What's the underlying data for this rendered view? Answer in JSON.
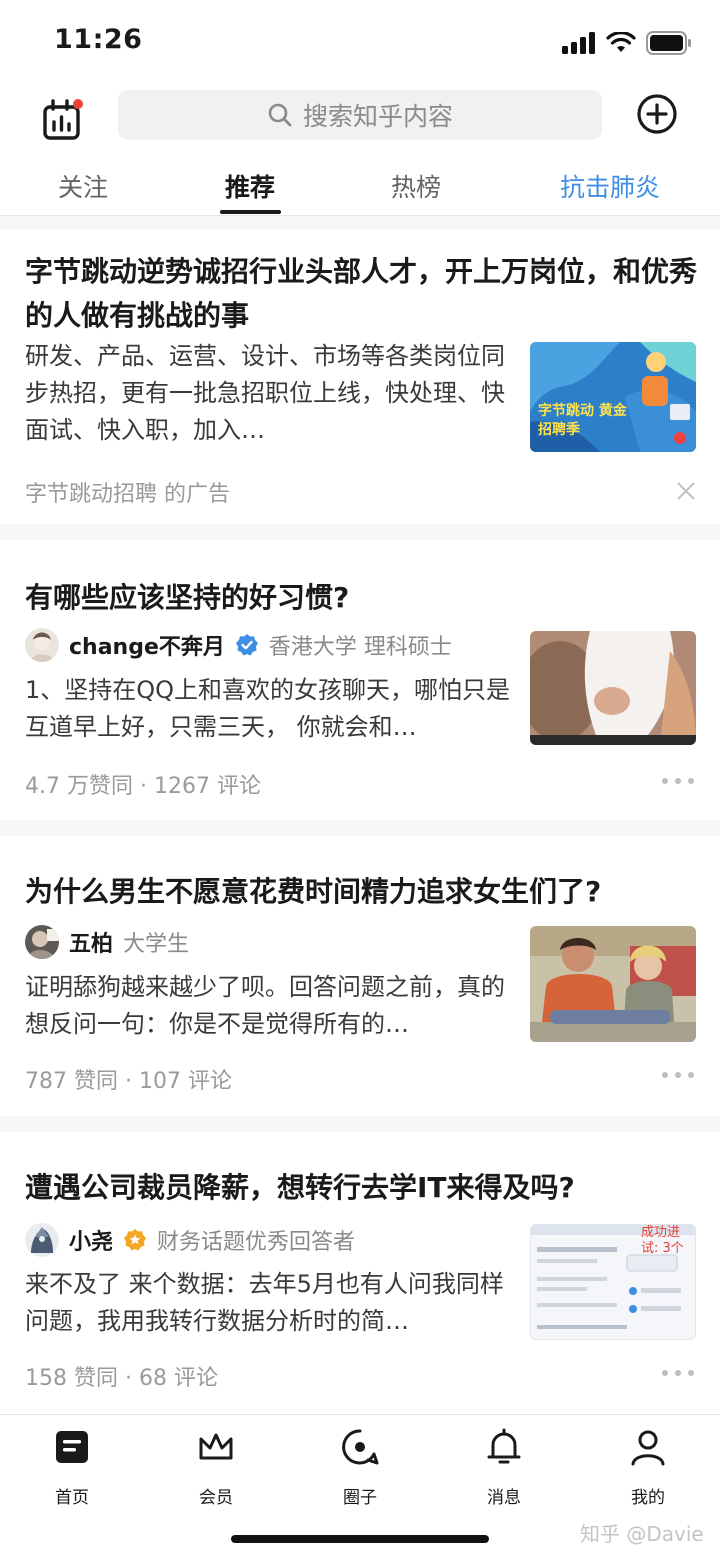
{
  "status_bar": {
    "time": "11:26"
  },
  "header": {
    "search_placeholder": "搜索知乎内容",
    "tabs": [
      {
        "label": "关注"
      },
      {
        "label": "推荐"
      },
      {
        "label": "热榜"
      },
      {
        "label": "抗击肺炎"
      }
    ],
    "active_tab": "推荐"
  },
  "feed": {
    "ad": {
      "title": "字节跳动逆势诚招行业头部人才，开上万岗位，和优秀的人做有挑战的事",
      "excerpt": "研发、产品、运营、设计、市场等各类岗位同步热招，更有一批急招职位上线，快处理、快面试、快入职，加入…",
      "thumb_text": "字节跳动 黄金招聘季",
      "sponsor": "字节跳动招聘 的广告"
    },
    "items": [
      {
        "title": "有哪些应该坚持的好习惯?",
        "author": "change不奔月",
        "verified": true,
        "bio": "香港大学 理科硕士",
        "excerpt": "1、坚持在QQ上和喜欢的女孩聊天，哪怕只是互道早上好，只需三天， 你就会和…",
        "stats": "4.7 万赞同 · 1267 评论"
      },
      {
        "title": "为什么男生不愿意花费时间精力追求女生们了?",
        "author": "五柏",
        "verified": false,
        "bio": "大学生",
        "excerpt": "证明舔狗越来越少了呗。回答问题之前，真的想反问一句：你是不是觉得所有的…",
        "stats": "787 赞同 · 107 评论"
      },
      {
        "title": "遭遇公司裁员降薪，想转行去学IT来得及吗?",
        "author": "小尧",
        "verified": true,
        "bio": "财务话题优秀回答者",
        "excerpt": "来不及了 来个数据：去年5月也有人问我同样问题，我用我转行数据分析时的简…",
        "stats": "158 赞同 · 68 评论",
        "thumb_text": "成功进 试: 3个"
      }
    ]
  },
  "bottom_nav": [
    {
      "label": "首页",
      "icon": "home-icon"
    },
    {
      "label": "会员",
      "icon": "crown-icon"
    },
    {
      "label": "圈子",
      "icon": "circle-chat-icon"
    },
    {
      "label": "消息",
      "icon": "bell-icon"
    },
    {
      "label": "我的",
      "icon": "person-icon"
    }
  ],
  "watermark": "知乎 @Davie",
  "colors": {
    "accent_blue": "#3d8ee4",
    "badge_orange": "#f5a623",
    "notification_red": "#f1403c"
  }
}
